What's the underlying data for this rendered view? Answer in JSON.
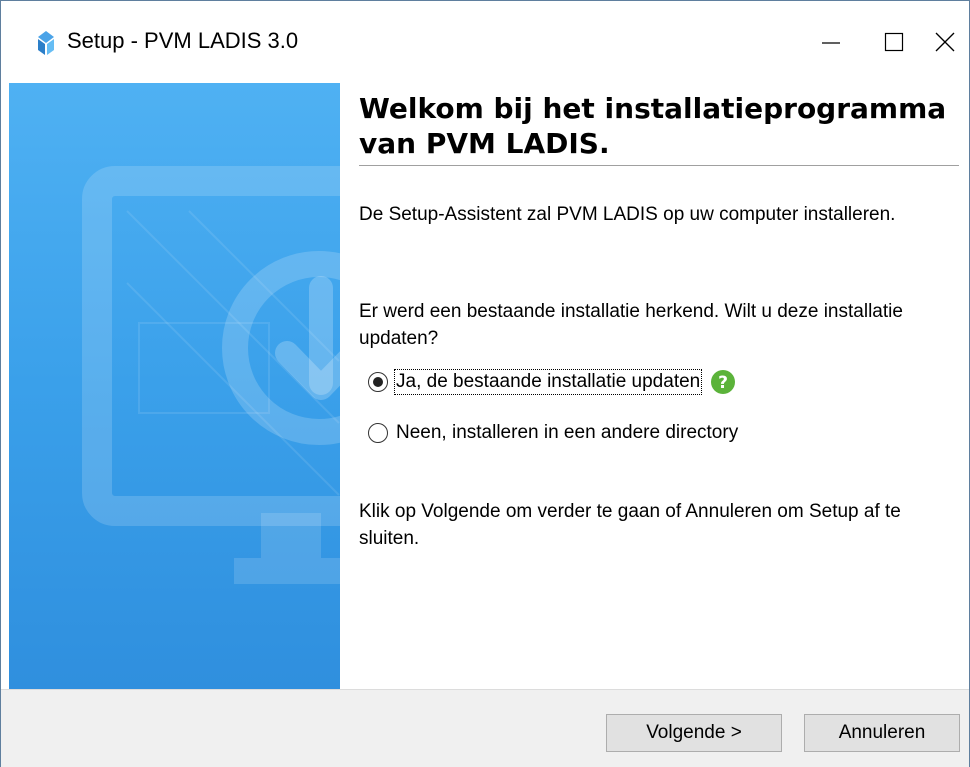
{
  "window": {
    "title": "Setup - PVM LADIS 3.0"
  },
  "titlebar_buttons": {
    "minimize": "minimize-icon",
    "maximize": "maximize-icon",
    "close": "close-icon"
  },
  "sidebar": {
    "illustration": "monitor-download-icon",
    "colors": {
      "top": "#4fb1f3",
      "bottom": "#2f8fde"
    }
  },
  "main": {
    "heading": "Welkom bij het installatieprogramma van PVM LADIS.",
    "intro": "De Setup-Assistent zal PVM LADIS op uw computer installeren.",
    "existing_prompt": "Er werd een bestaande installatie herkend. Wilt u deze installatie updaten?",
    "options": [
      {
        "label": "Ja, de bestaande installatie updaten",
        "selected": true
      },
      {
        "label": "Neen, installeren in een andere directory",
        "selected": false
      }
    ],
    "help_icon": "question-circle-icon",
    "help_color": "#5bb33a",
    "instruction": "Klik op Volgende om verder te gaan of Annuleren om Setup af te sluiten."
  },
  "footer": {
    "next_label": "Volgende >",
    "cancel_label": "Annuleren"
  }
}
